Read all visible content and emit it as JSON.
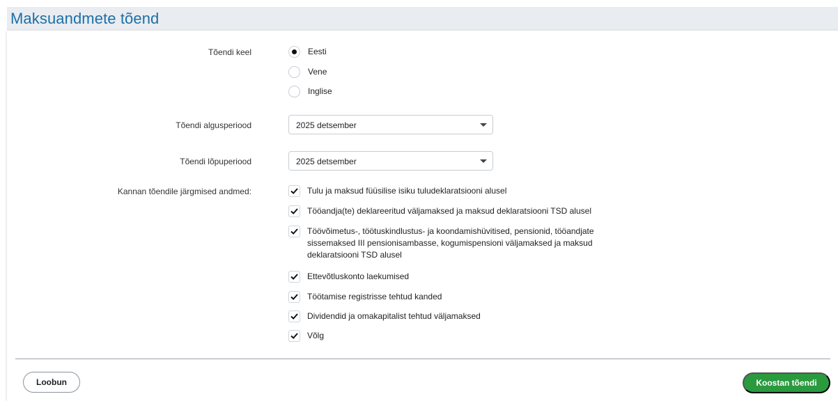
{
  "page": {
    "title": "Maksuandmete tõend"
  },
  "language": {
    "label": "Tõendi keel",
    "options": [
      {
        "label": "Eesti",
        "checked": true
      },
      {
        "label": "Vene",
        "checked": false
      },
      {
        "label": "Inglise",
        "checked": false
      }
    ]
  },
  "start_period": {
    "label": "Tõendi algusperiood",
    "value": "2025 detsember"
  },
  "end_period": {
    "label": "Tõendi lõpuperiood",
    "value": "2025 detsember"
  },
  "data_items": {
    "label": "Kannan tõendile järgmised andmed:",
    "items": [
      {
        "lines": [
          "Tulu ja maksud füüsilise isiku tuludeklaratsiooni alusel"
        ],
        "checked": true
      },
      {
        "lines": [
          "Tööandja(te) deklareeritud väljamaksed ja maksud deklaratsiooni TSD alusel"
        ],
        "checked": true
      },
      {
        "lines": [
          "Töövõimetus-, töötuskindlustus- ja koondamishüvitised, pensionid, tööandjate",
          "sissemaksed III pensionisambasse, kogumispensioni väljamaksed ja maksud",
          "deklaratsiooni TSD alusel"
        ],
        "checked": true
      },
      {
        "lines": [
          "Ettevõtluskonto laekumised"
        ],
        "checked": true
      },
      {
        "lines": [
          "Töötamise registrisse tehtud kanded"
        ],
        "checked": true
      },
      {
        "lines": [
          "Dividendid ja omakapitalist tehtud väljamaksed"
        ],
        "checked": true
      },
      {
        "lines": [
          "Võlg"
        ],
        "checked": true
      }
    ]
  },
  "footer": {
    "cancel_label": "Loobun",
    "submit_label": "Koostan tõendi"
  },
  "colors": {
    "title": "#1c6fa8",
    "primary": "#2a9a3f",
    "title_bar_bg": "#e9ecf0"
  }
}
